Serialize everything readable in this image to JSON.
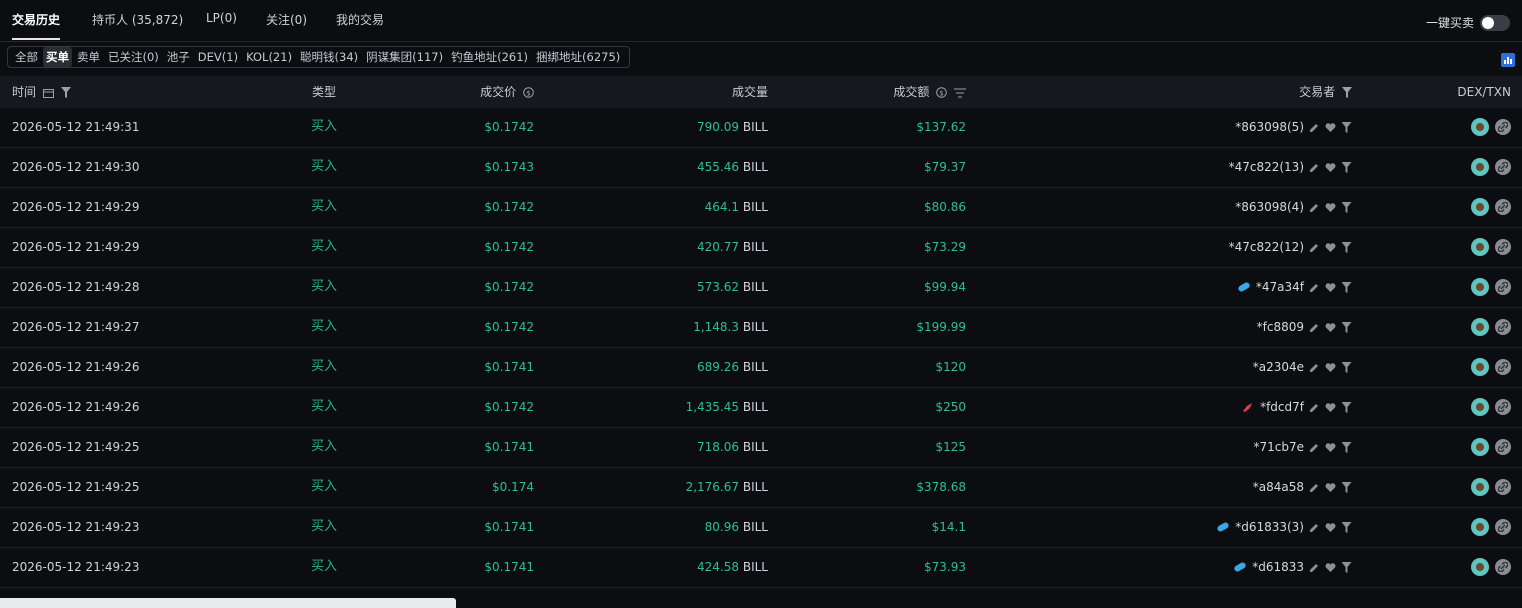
{
  "tabs": [
    {
      "label": "交易历史",
      "active": true
    },
    {
      "label": "持币人 (35,872)",
      "active": false
    },
    {
      "label": "LP(0)",
      "active": false
    },
    {
      "label": "关注(0)",
      "active": false
    },
    {
      "label": "我的交易",
      "active": false
    }
  ],
  "quick_trade": {
    "label": "一键买卖",
    "enabled": false
  },
  "filters": [
    {
      "label": "全部",
      "active": false
    },
    {
      "label": "买单",
      "active": true
    },
    {
      "label": "卖单",
      "active": false
    },
    {
      "label": "已关注(0)",
      "active": false
    },
    {
      "label": "池子",
      "active": false
    },
    {
      "label": "DEV(1)",
      "active": false
    },
    {
      "label": "KOL(21)",
      "active": false
    },
    {
      "label": "聪明钱(34)",
      "active": false
    },
    {
      "label": "阴谋集团(117)",
      "active": false
    },
    {
      "label": "钓鱼地址(261)",
      "active": false
    },
    {
      "label": "捆绑地址(6275)",
      "active": false
    }
  ],
  "columns": {
    "time": "时间",
    "type": "类型",
    "price": "成交价",
    "amount": "成交量",
    "usd": "成交额",
    "trader": "交易者",
    "dex": "DEX/TXN"
  },
  "unit": "BILL",
  "rows": [
    {
      "time": "2026-05-12 21:49:31",
      "type": "买入",
      "price": "$0.1742",
      "amount": "790.09",
      "usd": "$137.62",
      "trader": "*863098(5)",
      "tag": ""
    },
    {
      "time": "2026-05-12 21:49:30",
      "type": "买入",
      "price": "$0.1743",
      "amount": "455.46",
      "usd": "$79.37",
      "trader": "*47c822(13)",
      "tag": ""
    },
    {
      "time": "2026-05-12 21:49:29",
      "type": "买入",
      "price": "$0.1742",
      "amount": "464.1",
      "usd": "$80.86",
      "trader": "*863098(4)",
      "tag": ""
    },
    {
      "time": "2026-05-12 21:49:29",
      "type": "买入",
      "price": "$0.1742",
      "amount": "420.77",
      "usd": "$73.29",
      "trader": "*47c822(12)",
      "tag": ""
    },
    {
      "time": "2026-05-12 21:49:28",
      "type": "买入",
      "price": "$0.1742",
      "amount": "573.62",
      "usd": "$99.94",
      "trader": "*47a34f",
      "tag": "bundle"
    },
    {
      "time": "2026-05-12 21:49:27",
      "type": "买入",
      "price": "$0.1742",
      "amount": "1,148.3",
      "usd": "$199.99",
      "trader": "*fc8809",
      "tag": ""
    },
    {
      "time": "2026-05-12 21:49:26",
      "type": "买入",
      "price": "$0.1741",
      "amount": "689.26",
      "usd": "$120",
      "trader": "*a2304e",
      "tag": ""
    },
    {
      "time": "2026-05-12 21:49:26",
      "type": "买入",
      "price": "$0.1742",
      "amount": "1,435.45",
      "usd": "$250",
      "trader": "*fdcd7f",
      "tag": "rocket"
    },
    {
      "time": "2026-05-12 21:49:25",
      "type": "买入",
      "price": "$0.1741",
      "amount": "718.06",
      "usd": "$125",
      "trader": "*71cb7e",
      "tag": ""
    },
    {
      "time": "2026-05-12 21:49:25",
      "type": "买入",
      "price": "$0.174",
      "amount": "2,176.67",
      "usd": "$378.68",
      "trader": "*a84a58",
      "tag": ""
    },
    {
      "time": "2026-05-12 21:49:23",
      "type": "买入",
      "price": "$0.1741",
      "amount": "80.96",
      "usd": "$14.1",
      "trader": "*d61833(3)",
      "tag": "bundle"
    },
    {
      "time": "2026-05-12 21:49:23",
      "type": "买入",
      "price": "$0.1741",
      "amount": "424.58",
      "usd": "$73.93",
      "trader": "*d61833",
      "tag": "bundle"
    }
  ],
  "colors": {
    "buy": "#2fbf8f",
    "bg": "#0b0d10",
    "header_bg": "#15181c",
    "bundle_tag": "#3aa7e6",
    "rocket_tag": "#e23a50"
  }
}
